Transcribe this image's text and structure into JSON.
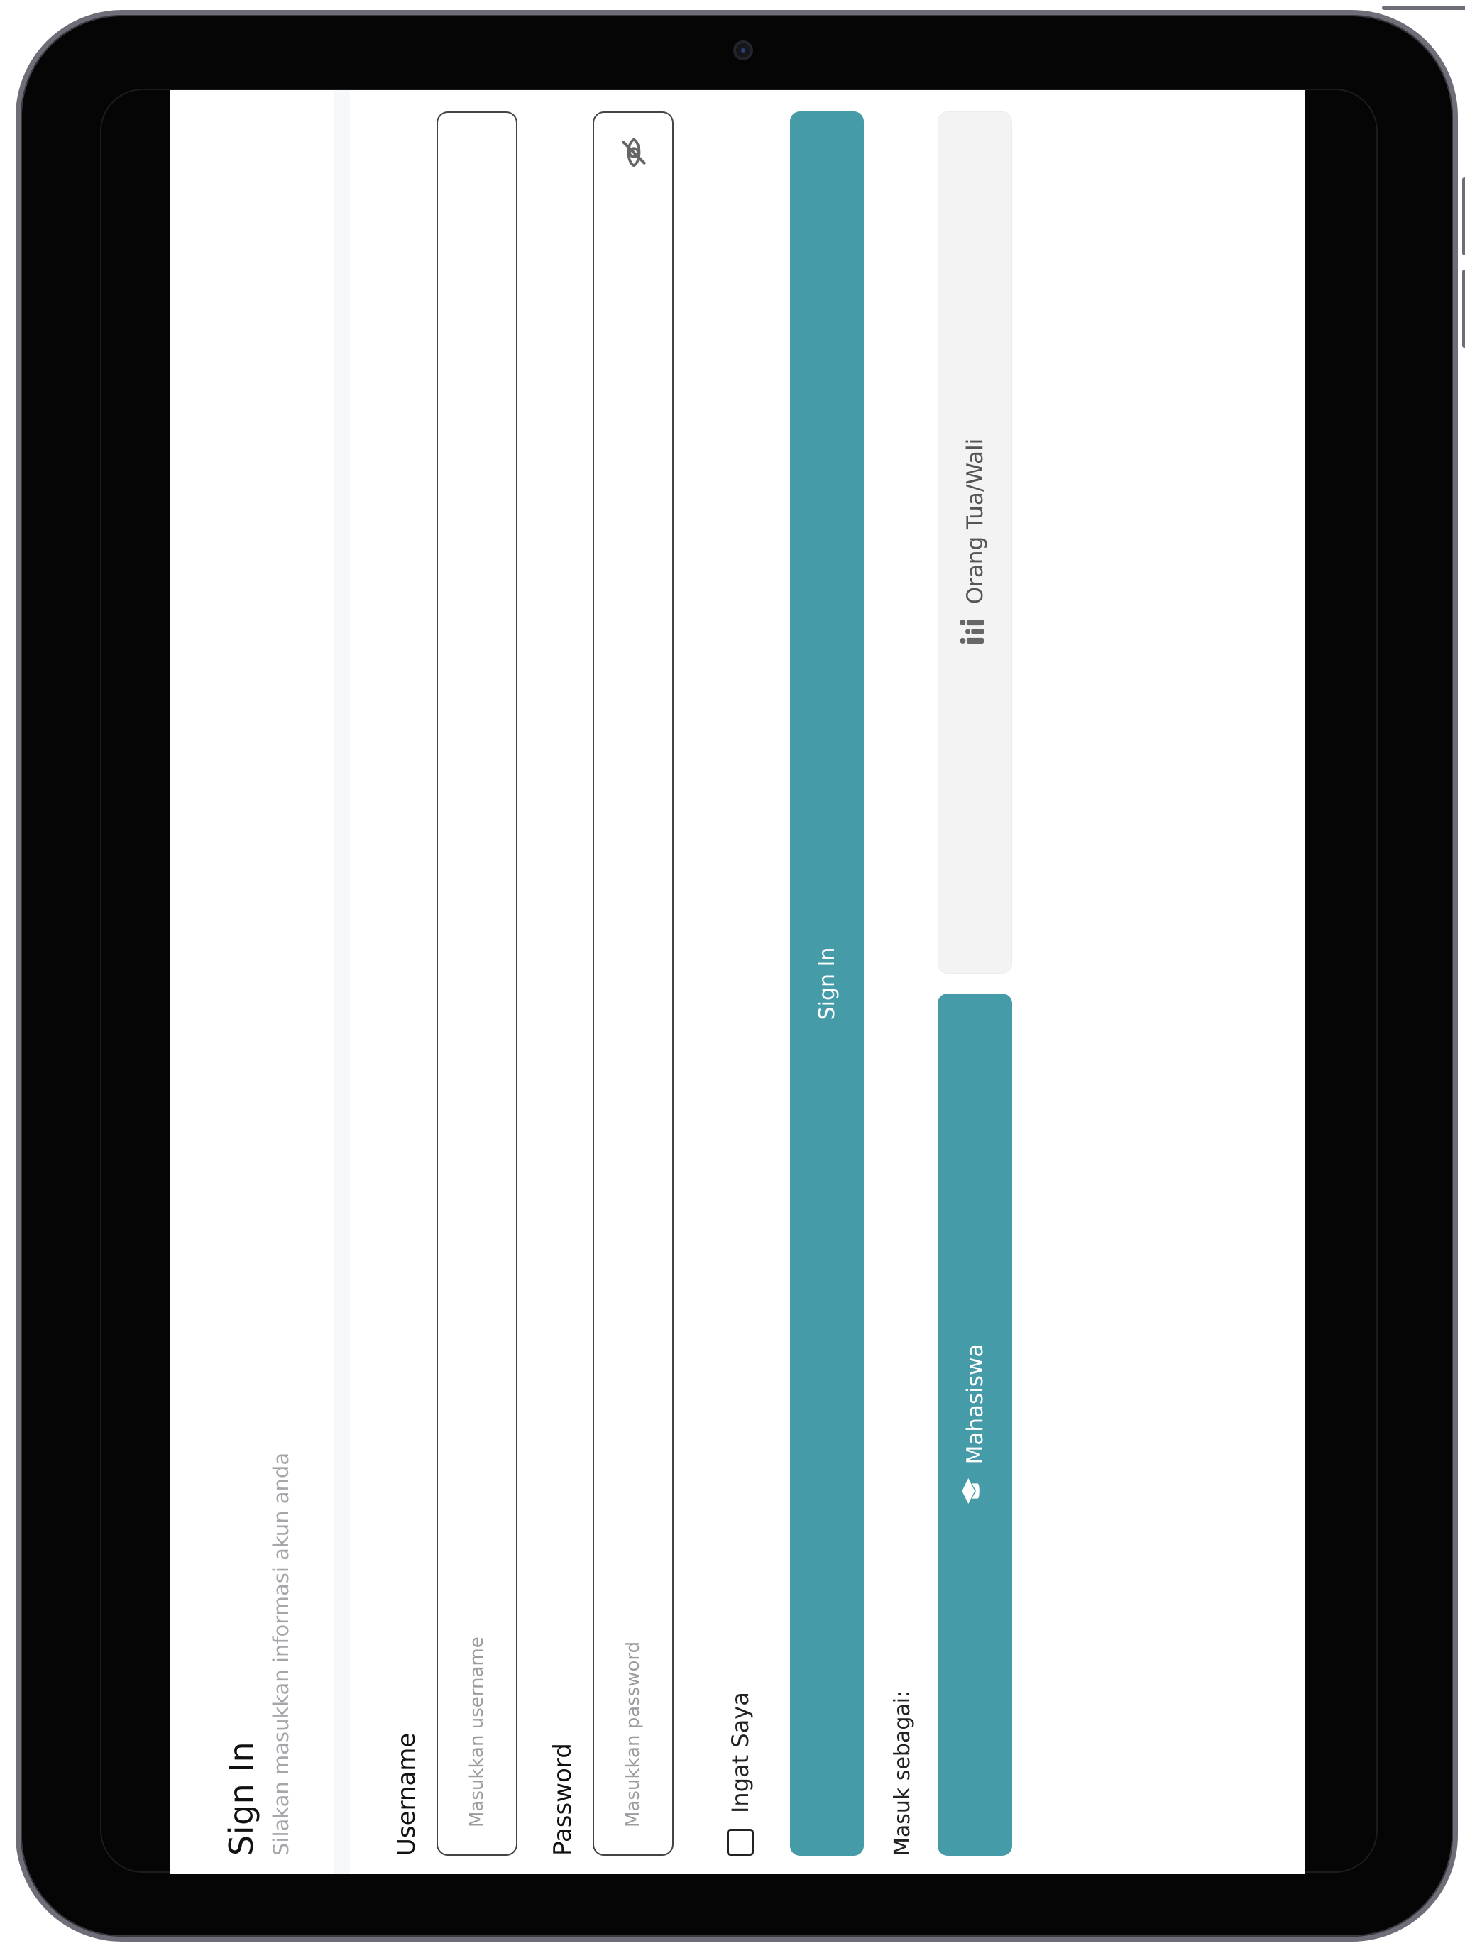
{
  "login": {
    "title": "Sign In",
    "subtitle": "Silakan masukkan informasi akun anda",
    "username": {
      "label": "Username",
      "placeholder": "Masukkan username",
      "value": ""
    },
    "password": {
      "label": "Password",
      "placeholder": "Masukkan password",
      "value": "",
      "toggle_icon": "eye-off-icon"
    },
    "remember": {
      "label": "Ingat Saya",
      "checked": false
    },
    "submit_label": "Sign In",
    "role_prompt": "Masuk sebagai:",
    "roles": [
      {
        "label": "Mahasiswa",
        "icon": "graduation-cap-icon",
        "selected": true
      },
      {
        "label": "Orang Tua/Wali",
        "icon": "family-icon",
        "selected": false
      }
    ]
  },
  "colors": {
    "accent": "#469ba9",
    "inactive_button": "#f3f3f3",
    "subtitle_text": "#a4a6aa"
  }
}
